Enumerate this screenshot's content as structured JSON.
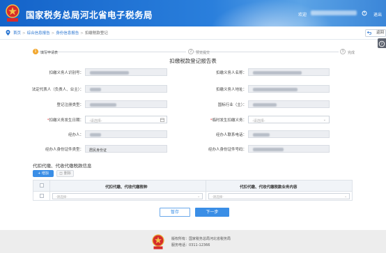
{
  "header": {
    "site_title": "国家税务总局河北省电子税务局",
    "welcome": "欢迎",
    "logout": "退出"
  },
  "breadcrumb": {
    "home": "首页",
    "comprehensive": "综合信息报告",
    "identity": "身份信息报告",
    "current": "扣缴税款登记"
  },
  "back_label": "返回",
  "steps": [
    {
      "num": "1",
      "label": "填写申请表"
    },
    {
      "num": "2",
      "label": "预览提交"
    },
    {
      "num": "3",
      "label": "完成"
    }
  ],
  "form": {
    "title": "扣缴税款登记报告表",
    "fields": {
      "withholder_id": {
        "label": "扣缴义务人识别号："
      },
      "withholder_name": {
        "label": "扣缴义务人名称："
      },
      "legal_rep": {
        "label": "法定代表人（负责人、业主）："
      },
      "withholder_addr": {
        "label": "扣缴义务人地址："
      },
      "reg_type": {
        "label": "登记注册类型："
      },
      "industry": {
        "label": "国标行业（主）："
      },
      "occur_date": {
        "label": "扣缴义务发生日期：",
        "placeholder": "-请选择-"
      },
      "temp_duty": {
        "label": "临时发生扣缴义务：",
        "placeholder": "-请选择-"
      },
      "agent": {
        "label": "经办人："
      },
      "agent_phone": {
        "label": "经办人联系电话："
      },
      "agent_id_type": {
        "label": "经办人身份证件类型：",
        "value": "居民身份证"
      },
      "agent_id_no": {
        "label": "经办人身份证件号码："
      }
    }
  },
  "subsection": {
    "title": "代扣代缴、代收代缴税款信息",
    "add": "+ 增加",
    "delete": "删除",
    "columns": [
      "代扣代缴、代收代缴税种",
      "代扣代缴、代收代缴税款业务内容"
    ],
    "row_placeholder": "-请选择-"
  },
  "actions": {
    "save": "暂存",
    "next": "下一步"
  },
  "footer": {
    "owner": "版权所有：国家税务总局河北省税务局",
    "phone": "服务电话：0311-12366"
  },
  "colors": {
    "banner": "#1463c9",
    "primary": "#3a8ee6",
    "step_active": "#f2a72e",
    "required": "#e23c3c"
  }
}
